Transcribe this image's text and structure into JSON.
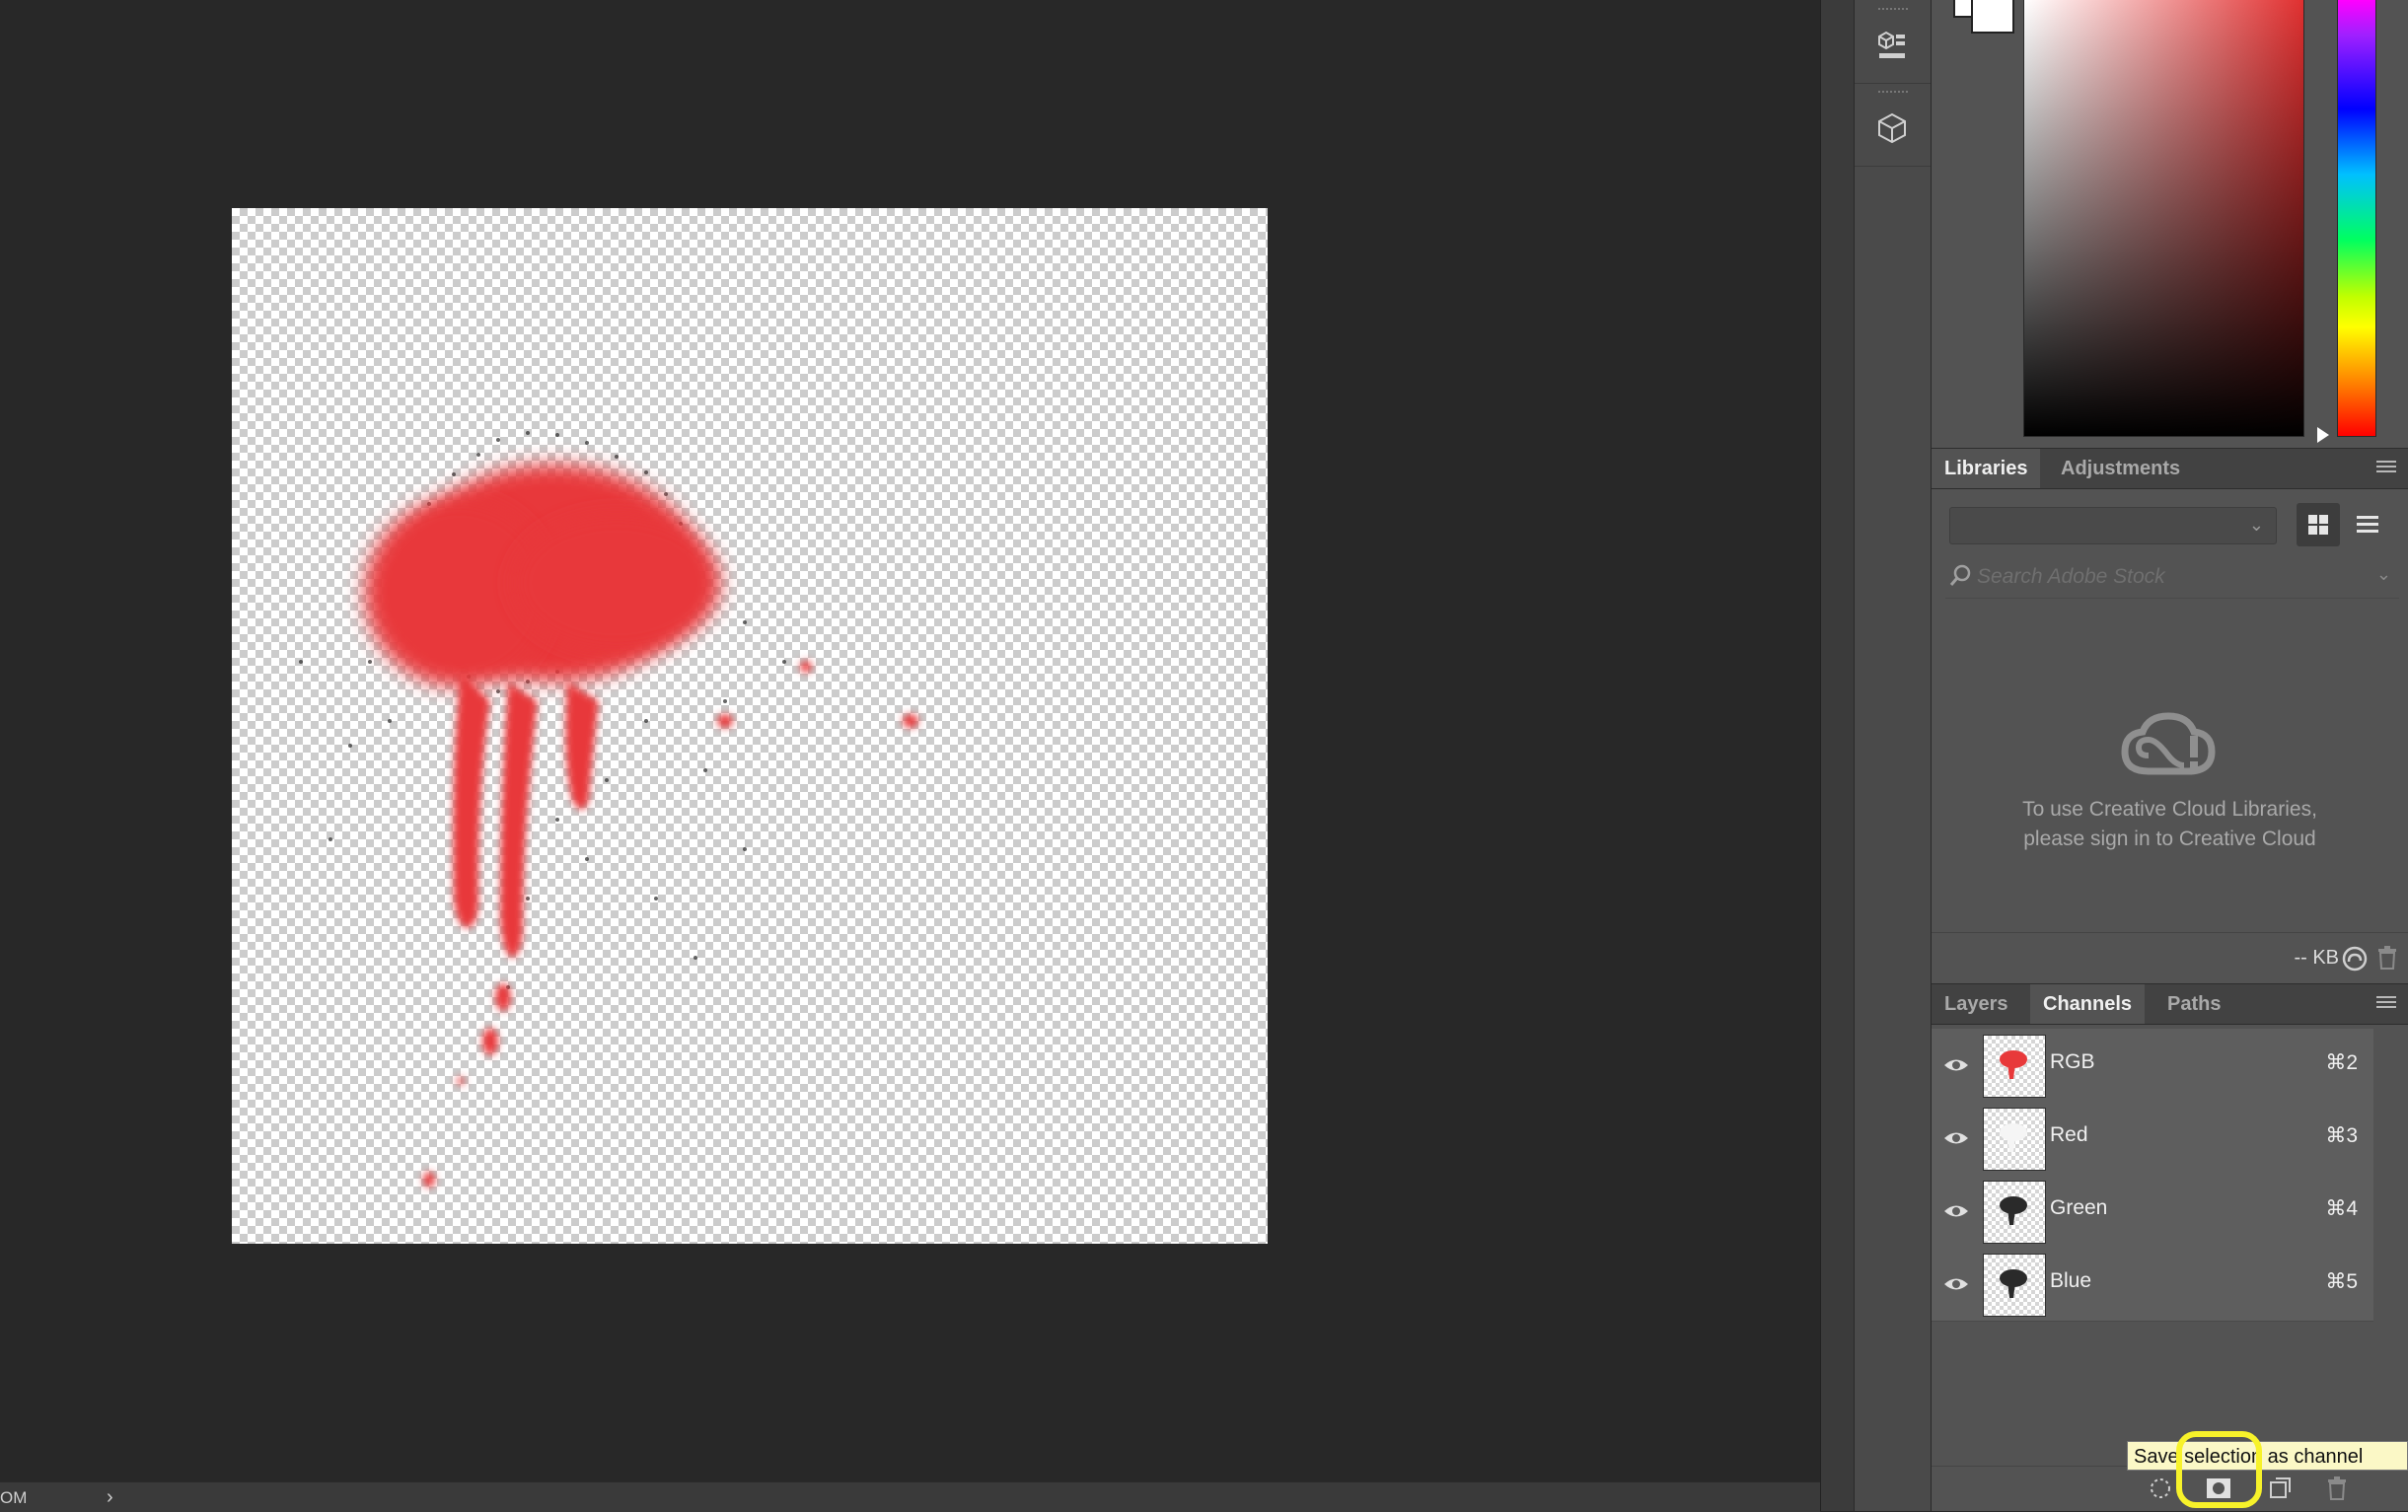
{
  "status_bar": {
    "zoom": "OM",
    "arrow": "›"
  },
  "color_panel": {
    "foreground": "#ffffff",
    "background": "#ffffff",
    "hue_base": "#e03030"
  },
  "libraries_panel": {
    "tabs": [
      {
        "label": "Libraries",
        "active": true
      },
      {
        "label": "Adjustments",
        "active": false
      }
    ],
    "search_placeholder": "Search Adobe Stock",
    "message_line1": "To use Creative Cloud Libraries,",
    "message_line2": "please sign in to Creative Cloud",
    "size": "-- KB"
  },
  "channels_panel": {
    "tabs": [
      {
        "label": "Layers",
        "active": false
      },
      {
        "label": "Channels",
        "active": true
      },
      {
        "label": "Paths",
        "active": false
      }
    ],
    "rows": [
      {
        "name": "RGB",
        "shortcut": "⌘2"
      },
      {
        "name": "Red",
        "shortcut": "⌘3"
      },
      {
        "name": "Green",
        "shortcut": "⌘4"
      },
      {
        "name": "Blue",
        "shortcut": "⌘5"
      }
    ],
    "tooltip": "Save selection as channel"
  },
  "document": {
    "paint_color": "#e8393a"
  }
}
